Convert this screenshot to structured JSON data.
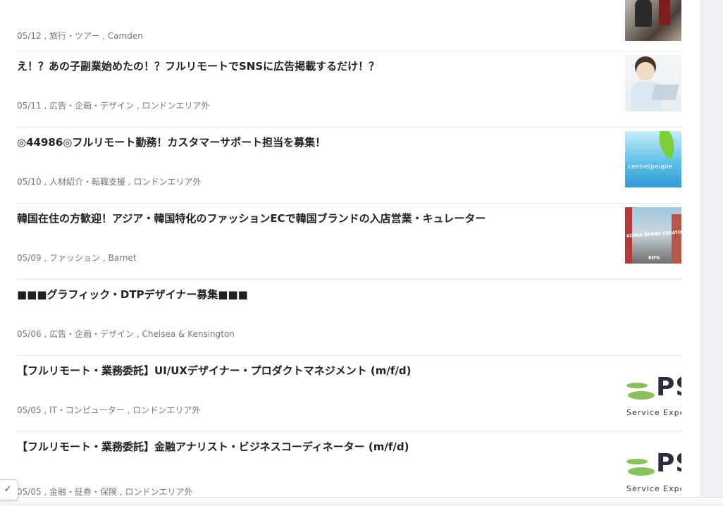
{
  "jobs": [
    {
      "title": "",
      "date": "05/12",
      "category": "旅行・ツアー",
      "location": "Camden",
      "thumb": "tour-photo"
    },
    {
      "title": "え！？あの子副業始めたの！？フルリモートでSNSに広告掲載するだけ！？",
      "date": "05/11",
      "category": "広告・企画・デザイン",
      "location": "ロンドンエリア外",
      "thumb": "laptop-woman-photo"
    },
    {
      "title": "◎44986◎フルリモート勤務！カスタマーサポート担当を募集！",
      "date": "05/10",
      "category": "人材紹介・転職支援",
      "location": "ロンドンエリア外",
      "thumb": "centre-people-logo",
      "thumb_text": "centre(people"
    },
    {
      "title": "韓国在住の方歓迎！アジア・韓国特化のファッションECで韓国ブランドの入店営業・キュレーター",
      "date": "05/09",
      "category": "ファッション",
      "location": "Barnet",
      "thumb": "korea-curator-photo",
      "thumb_text": "KOREA BRAND CURATOR / SALES",
      "thumb_badge": "60%"
    },
    {
      "title": "■■■グラフィック・DTPデザイナー募集■■■",
      "date": "05/06",
      "category": "広告・企画・デザイン",
      "location": "Chelsea & Kensington",
      "thumb": ""
    },
    {
      "title": "【フルリモート・業務委託】UI/UXデザイナー・プロダクトマネジメント (m/f/d)",
      "date": "05/05",
      "category": "IT・コンピューター",
      "location": "ロンドンエリア外",
      "thumb": "pse-logo",
      "thumb_letters": "PS",
      "thumb_text": "Service Expe"
    },
    {
      "title": "【フルリモート・業務委託】金融アナリスト・ビジネスコーディネーター (m/f/d)",
      "date": "05/05",
      "category": "金融・証券・保険",
      "location": "ロンドンエリア外",
      "thumb": "pse-logo",
      "thumb_letters": "PS",
      "thumb_text": "Service Expe"
    }
  ],
  "separator": " , ",
  "corner_toggle_icon": "✓",
  "colors": {
    "title": "#222222",
    "meta": "#777777",
    "divider": "#e8e8e8",
    "gutter": "#eff0f4"
  }
}
